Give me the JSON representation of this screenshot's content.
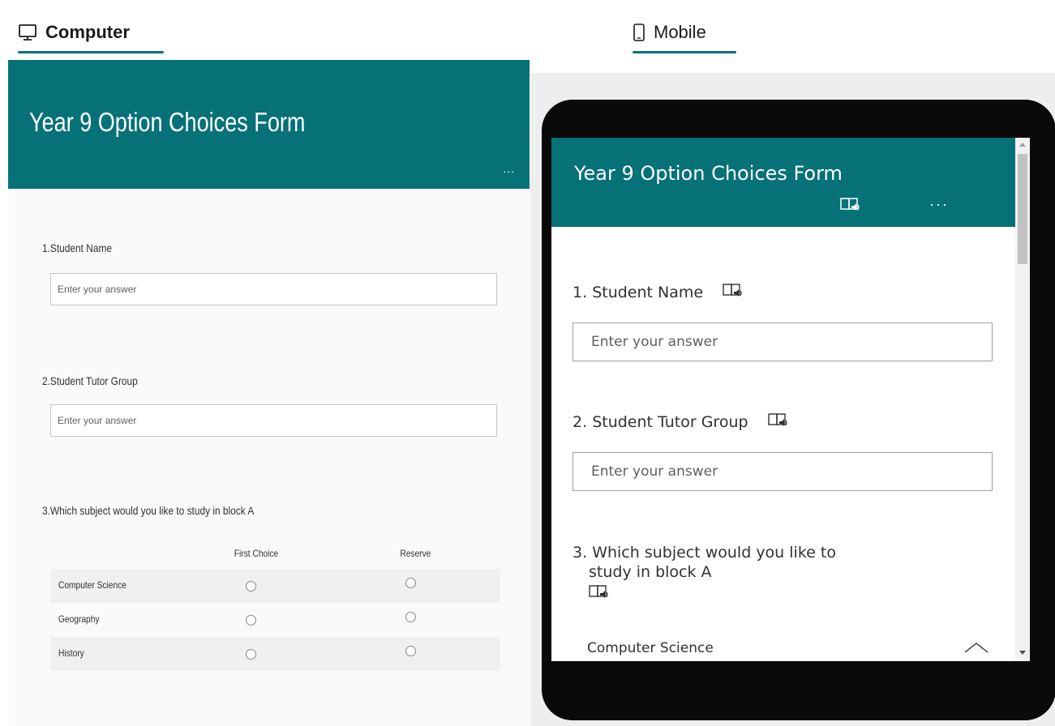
{
  "tabs": {
    "computer": {
      "label": "Computer",
      "icon": "monitor-icon",
      "active": true
    },
    "mobile": {
      "label": "Mobile",
      "icon": "phone-icon"
    }
  },
  "form": {
    "title": "Year 9 Option Choices Form",
    "more_label": "...",
    "accent_color": "#077178"
  },
  "questions": {
    "q1": {
      "number": "1.",
      "text": "Student Name",
      "placeholder": "Enter your answer"
    },
    "q2": {
      "number": "2.",
      "text": "Student Tutor Group",
      "placeholder": "Enter your answer"
    },
    "q3": {
      "number": "3.",
      "text": "Which subject would you like to study in block A",
      "text_line1": "Which subject would you like to",
      "text_line2": "study in block A"
    }
  },
  "grid": {
    "columns": [
      "First Choice",
      "Reserve"
    ],
    "rows": [
      "Computer Science",
      "Geography",
      "History"
    ]
  },
  "mobile": {
    "more_label": "···",
    "visible_row": "Computer Science"
  }
}
